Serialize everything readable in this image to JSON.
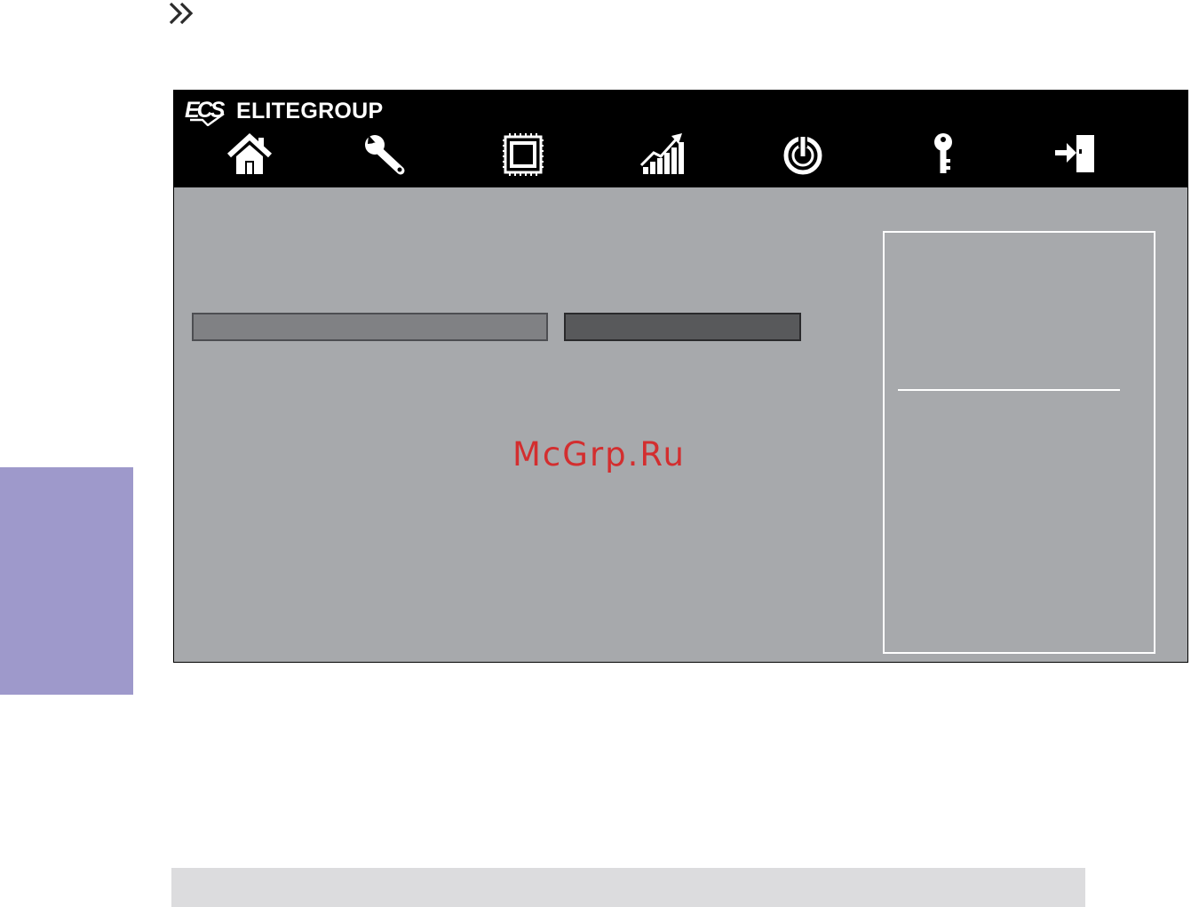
{
  "page": {
    "background": "#ffffff",
    "continue_icon": "double-chevron-right-icon"
  },
  "side_tab": {
    "color": "#9e99cb"
  },
  "bios": {
    "brand": {
      "logo": "ecs-logo",
      "name": "ELITEGROUP"
    },
    "header_color": "#000000",
    "body_color": "#a7a9ac",
    "icon_color": "#ffffff",
    "nav": [
      {
        "id": "main",
        "icon": "home-icon"
      },
      {
        "id": "advanced",
        "icon": "wrench-icon"
      },
      {
        "id": "chipset",
        "icon": "chip-icon"
      },
      {
        "id": "m.i.b",
        "icon": "chart-arrow-icon"
      },
      {
        "id": "boot",
        "icon": "power-icon"
      },
      {
        "id": "security",
        "icon": "key-icon"
      },
      {
        "id": "exit",
        "icon": "exit-icon"
      }
    ],
    "option": {
      "label_box_color": "#808184",
      "value_box_color": "#58595b"
    },
    "help_panel": {
      "border_color": "#ffffff"
    }
  },
  "watermark": {
    "text": "McGrp.Ru",
    "color": "#d32e2f"
  },
  "footer": {
    "color": "#dcdcde"
  }
}
